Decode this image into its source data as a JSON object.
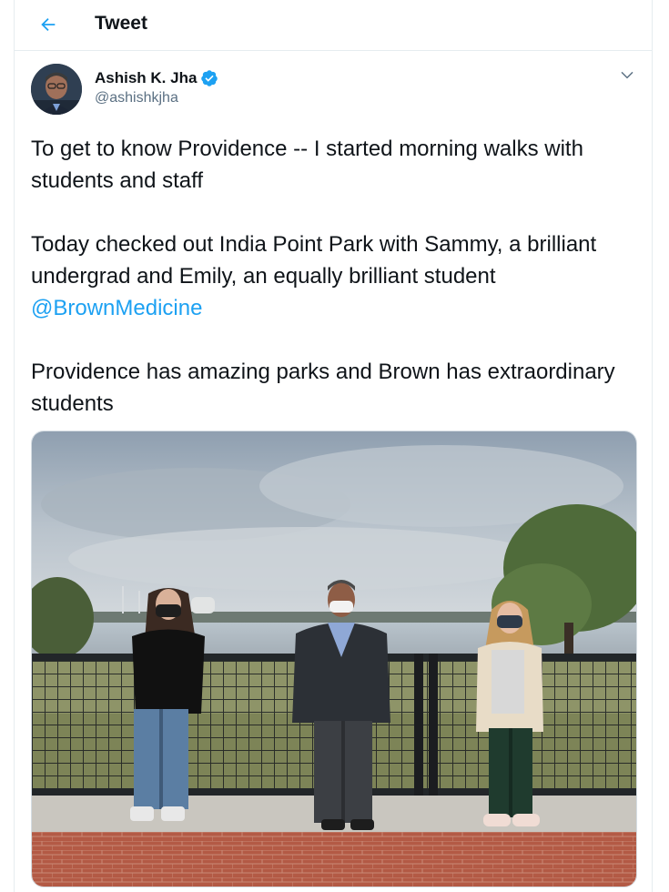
{
  "header": {
    "title": "Tweet",
    "back_icon": "arrow-left-icon"
  },
  "author": {
    "name": "Ashish K. Jha",
    "handle": "@ashishkjha",
    "verified_icon": "verified-badge-icon",
    "more_icon": "chevron-down-icon"
  },
  "tweet": {
    "para1": "To get to know Providence -- I started morning walks with students and staff",
    "para2_text": "Today checked out India Point Park with Sammy, a brilliant undergrad and Emily, an equally brilliant student",
    "mention": "@BrownMedicine",
    "para3": "Providence has amazing parks and Brown has extraordinary students"
  },
  "colors": {
    "accent": "#1da1f2",
    "text": "#0f1419",
    "muted": "#5b7083",
    "border": "#e6ecf0"
  }
}
